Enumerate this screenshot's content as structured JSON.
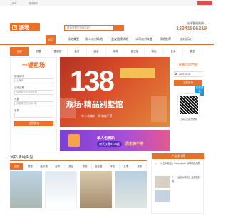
{
  "topbar": {
    "login": "上海市",
    "city": "选择城市"
  },
  "header": {
    "logo": "派场",
    "search_placeholder": "搜索您要的场地名称",
    "hot_label": "派场客服热线",
    "phone": "13341896219"
  },
  "nav": {
    "items": [
      "首页",
      "场地类型",
      "私人派对场地",
      "会议团建场地",
      "公司派对年会",
      "场地推荐",
      "派对活动",
      "策划专题"
    ]
  },
  "categories": [
    "全部",
    "别墅",
    "轰趴馆",
    "会所",
    "酒店",
    "商务",
    "会议室",
    "特色",
    "艺术",
    "更多"
  ],
  "booking": {
    "title": "一键租场",
    "city_label": "场地城市",
    "city_value": "上海市",
    "date_label": "活动日期",
    "date_value": "请选择您的活动日期",
    "people_label": "人数",
    "people_value": "请选择您的活动人数",
    "phone_label": "手机",
    "submit": "立即咨询"
  },
  "banner": {
    "price": "138",
    "slogan": "派场·精品别墅馆",
    "sub": "单人也嗨趴 · 周末嗨不停"
  },
  "promo": {
    "line1": "单人也嗨趴",
    "tag": "每天仅需¥138起",
    "line2": "周末嗨不停"
  },
  "right": {
    "title": "查看活动档期",
    "date": "2025-01-02",
    "button": "立即咨询",
    "wechat": "在线咨询",
    "qr_label": "扫码关注官方微信"
  },
  "section": {
    "title": "派趴场地类型",
    "tabs": [
      "全部",
      "别墅",
      "轰趴馆",
      "会所",
      "酒店",
      "商务",
      "会议室",
      "特色",
      "艺术",
      "更多"
    ]
  },
  "products": {
    "title": "产品排行榜",
    "item1": "1、【派五洲新区】Party space 派场精品别墅",
    "item2": "2、【派五洲新区】品质轰趴馆"
  },
  "colors": {
    "accent": "#e8702a"
  }
}
